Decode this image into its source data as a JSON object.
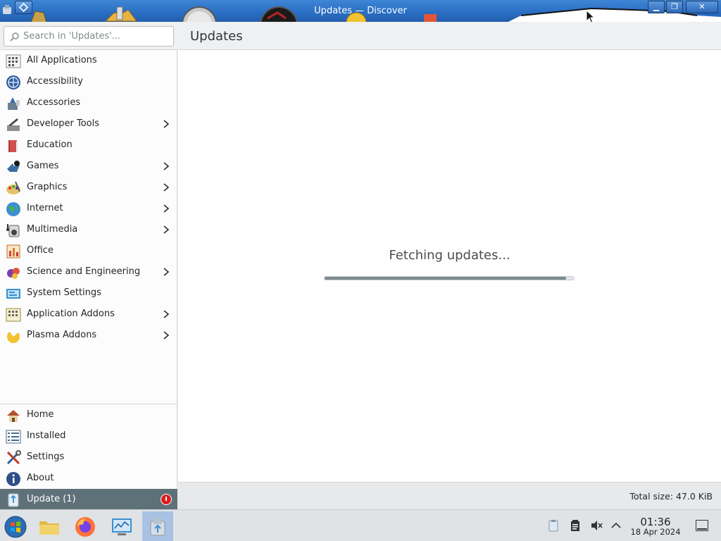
{
  "window": {
    "title": "Updates — Discover",
    "controls": {
      "minimize": "▁",
      "maximize": "❐",
      "close": "✕"
    }
  },
  "search": {
    "placeholder": "Search in 'Updates'..."
  },
  "sidebar": {
    "categories": [
      {
        "label": "All Applications",
        "icon": "grid-icon",
        "has_submenu": false
      },
      {
        "label": "Accessibility",
        "icon": "accessibility-icon",
        "has_submenu": false
      },
      {
        "label": "Accessories",
        "icon": "accessories-icon",
        "has_submenu": false
      },
      {
        "label": "Developer Tools",
        "icon": "developer-tools-icon",
        "has_submenu": true
      },
      {
        "label": "Education",
        "icon": "education-icon",
        "has_submenu": false
      },
      {
        "label": "Games",
        "icon": "games-icon",
        "has_submenu": true
      },
      {
        "label": "Graphics",
        "icon": "graphics-icon",
        "has_submenu": true
      },
      {
        "label": "Internet",
        "icon": "internet-icon",
        "has_submenu": true
      },
      {
        "label": "Multimedia",
        "icon": "multimedia-icon",
        "has_submenu": true
      },
      {
        "label": "Office",
        "icon": "office-icon",
        "has_submenu": false
      },
      {
        "label": "Science and Engineering",
        "icon": "science-icon",
        "has_submenu": true
      },
      {
        "label": "System Settings",
        "icon": "system-settings-icon",
        "has_submenu": false
      },
      {
        "label": "Application Addons",
        "icon": "application-addons-icon",
        "has_submenu": true
      },
      {
        "label": "Plasma Addons",
        "icon": "plasma-addons-icon",
        "has_submenu": true
      }
    ],
    "nav": [
      {
        "label": "Home",
        "icon": "home-icon"
      },
      {
        "label": "Installed",
        "icon": "installed-icon"
      },
      {
        "label": "Settings",
        "icon": "settings-icon"
      },
      {
        "label": "About",
        "icon": "about-icon"
      }
    ],
    "update": {
      "label": "Update (1)",
      "icon": "update-icon",
      "selected": true,
      "status": "alert"
    }
  },
  "main": {
    "title": "Updates",
    "status_text": "Fetching updates...",
    "progress_fraction": 0.97,
    "total_size": "Total size: 47.0 KiB"
  },
  "taskbar": {
    "launchers": [
      "start-menu-icon",
      "file-manager-icon",
      "firefox-icon",
      "system-monitor-icon",
      "discover-icon"
    ],
    "active_launcher": "discover-icon",
    "tray": [
      "clipboard-tray-icon",
      "notes-tray-icon",
      "volume-muted-icon",
      "expand-tray-icon"
    ],
    "clock": {
      "time": "01:36",
      "date": "18 Apr 2024"
    }
  },
  "colors": {
    "titlebar": "#2a6fc4",
    "selection": "#5f7178",
    "alert": "#da1f1f",
    "progress_fill": "#7c8a90"
  }
}
